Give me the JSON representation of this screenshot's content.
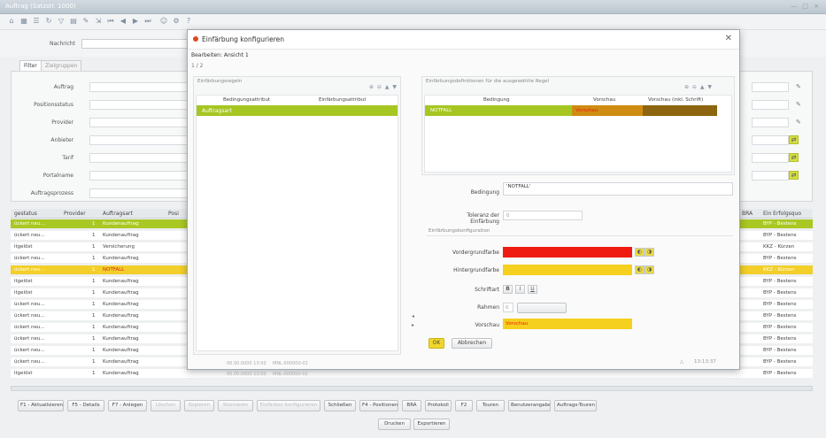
{
  "window": {
    "title": "Auftrag (Satzstr. 1000)",
    "controls": "— □ ×"
  },
  "search": {
    "label": "Nachricht"
  },
  "tabs": [
    "Filter",
    "Zielgruppen"
  ],
  "filter_labels": [
    "Auftrag",
    "Positionsstatus",
    "Provider",
    "Anbieter",
    "Tarif",
    "Portalname",
    "Auftragsprozess"
  ],
  "columns": [
    "gestatus",
    "Provider",
    "Auftragsart",
    "Posi",
    "BRA",
    "Ein Erfolgsquo"
  ],
  "rows": [
    {
      "status": "ückert neu...",
      "n": "1",
      "art": "Kundenauftrag",
      "right": "BYP - Bestens",
      "style": "green"
    },
    {
      "status": "ückert neu...",
      "n": "1",
      "art": "Kundenauftrag",
      "right": "BYP - Bestens",
      "style": ""
    },
    {
      "status": "itgelöst",
      "n": "1",
      "art": "Versicherung",
      "right": "KKZ - Kürzen",
      "style": ""
    },
    {
      "status": "ückert neu...",
      "n": "1",
      "art": "Kundenauftrag",
      "right": "BYP - Bestens",
      "style": ""
    },
    {
      "status": "ückert neu...",
      "n": "1",
      "art": "NOTFALL",
      "right": "KKZ - Kürzen",
      "style": "yellow"
    },
    {
      "status": "itgelöst",
      "n": "1",
      "art": "Kundenauftrag",
      "right": "BYP - Bestens",
      "style": ""
    },
    {
      "status": "itgelöst",
      "n": "1",
      "art": "Kundenauftrag",
      "right": "BYP - Bestens",
      "style": ""
    },
    {
      "status": "ückert neu...",
      "n": "1",
      "art": "Kundenauftrag",
      "right": "BYP - Bestens",
      "style": ""
    },
    {
      "status": "ückert neu...",
      "n": "1",
      "art": "Kundenauftrag",
      "right": "BYP - Bestens",
      "style": ""
    },
    {
      "status": "ückert neu...",
      "n": "1",
      "art": "Kundenauftrag",
      "right": "BYP - Bestens",
      "style": ""
    },
    {
      "status": "ückert neu...",
      "n": "1",
      "art": "Kundenauftrag",
      "right": "BYP - Bestens",
      "style": ""
    },
    {
      "status": "ückert neu...",
      "n": "1",
      "art": "Kundenauftrag",
      "right": "BYP - Bestens",
      "style": ""
    },
    {
      "status": "ückert neu...",
      "n": "1",
      "art": "Kundenauftrag",
      "right": "BYP - Bestens",
      "style": ""
    },
    {
      "status": "itgelöst",
      "n": "1",
      "art": "Kundenauftrag",
      "right": "BYP - Bestens",
      "style": ""
    }
  ],
  "bottom_buttons": [
    {
      "label": "F1 - Aktualisieren",
      "enabled": true
    },
    {
      "label": "F5 - Details",
      "enabled": true
    },
    {
      "label": "F7 - Anlegen",
      "enabled": true
    },
    {
      "label": "Löschen",
      "enabled": false
    },
    {
      "label": "Kopieren",
      "enabled": false
    },
    {
      "label": "Stornieren",
      "enabled": false
    },
    {
      "label": "Einfärben konfigurieren",
      "enabled": false
    },
    {
      "label": "Schließen",
      "enabled": true
    },
    {
      "label": "F4 - Positionen",
      "enabled": true
    },
    {
      "label": "BRA",
      "enabled": true
    },
    {
      "label": "Protokoll",
      "enabled": true
    },
    {
      "label": "F2",
      "enabled": true
    },
    {
      "label": "Touren",
      "enabled": true
    },
    {
      "label": "Benutzerangaben",
      "enabled": true
    },
    {
      "label": "Auftrags-Touren",
      "enabled": true
    }
  ],
  "bottom_buttons_row2": [
    "Drucken",
    "Exportieren"
  ],
  "dialog": {
    "title": "Einfärbung konfigurieren",
    "crumb": "Bearbeiten: Ansicht 1",
    "step": "1 / 2",
    "left_group_title": "Einfärbungsregeln",
    "left_cols": [
      "Bedingungsattribut",
      "Einfärbungsattribut"
    ],
    "left_row": "Auftragsart",
    "right_group_title": "Einfärbungsdefinitionen für die ausgewählte Regel",
    "right_cols": [
      "Bedingung",
      "Vorschau",
      "Vorschau (inkl. Schrift)"
    ],
    "right_row": {
      "cond": "NOTFALL",
      "preview": "Vorschau"
    },
    "cond_label": "Bedingung",
    "cond_value": "'NOTFALL'",
    "tolerance_label": "Toleranz der Einfärbung",
    "tolerance_value": "0",
    "section_label": "Einfärbungskonfiguration",
    "fg_label": "Vordergrundfarbe",
    "bg_label": "Hintergrundfarbe",
    "font_label": "Schriftart",
    "font_buttons": [
      "B",
      "I",
      "U"
    ],
    "border_label": "Rahmen",
    "border_value": "0",
    "preview_label": "Vorschau",
    "preview_value": "Vorschau",
    "ok": "OK",
    "cancel": "Abbrechen",
    "footer_time": "13:13:37",
    "footer_dates": [
      "00.00.0000 13:00",
      "MNL-000000-01",
      "00.00.0000 13:00",
      "MNL-000000-02"
    ],
    "colors": {
      "fg": "#ef1c12",
      "bg": "#f5d01e",
      "row_green": "#a6c622",
      "preview_orange": "#cf8c12",
      "preview_dark": "#8c650e"
    }
  }
}
